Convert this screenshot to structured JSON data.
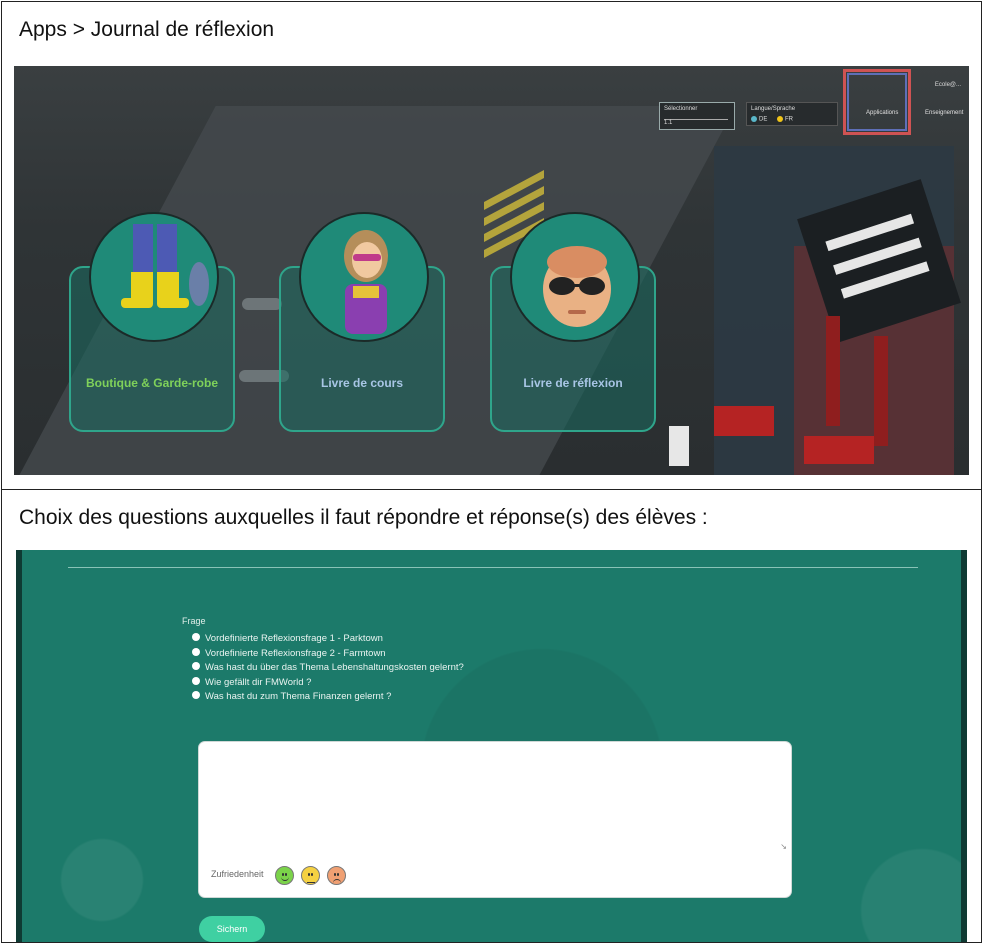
{
  "captions": {
    "apps_path": "Apps > Journal de réflexion",
    "choice_text": "Choix des questions auxquelles il faut répondre et réponse(s) des élèves :"
  },
  "apps_screen": {
    "topbar": {
      "email": "Ecole@...",
      "select_label": "Sélectionner",
      "select_value": "1.1",
      "language_label": "Langue/Sprache",
      "language_options": [
        "DE",
        "FR"
      ],
      "menu_apps": "Applications",
      "menu_education": "Enseignement"
    },
    "cards": [
      {
        "label": "Boutique & Garde-robe",
        "icon": "costume-icon"
      },
      {
        "label": "Livre de cours",
        "icon": "avatar-girl-icon"
      },
      {
        "label": "Livre de réflexion",
        "icon": "avatar-sunglasses-icon"
      }
    ],
    "colors": {
      "card_border": "#2fa58b",
      "highlight": "#cf5353",
      "label_active": "#7fd15a"
    }
  },
  "reflection_screen": {
    "frage_title": "Frage",
    "questions": [
      "Vordefinierte Reflexionsfrage 1 - Parktown",
      "Vordefinierte Reflexionsfrage 2 - Farmtown",
      "Was hast du über das Thema Lebenshaltungskosten gelernt?",
      "Wie gefällt dir FMWorld ?",
      "Was hast du zum Thema Finanzen gelernt ?"
    ],
    "answer_placeholder": "",
    "satisfaction_label": "Zufriedenheit",
    "smileys": [
      "happy-smiley-icon",
      "neutral-smiley-icon",
      "sad-smiley-icon"
    ],
    "save_label": "Sichern",
    "colors": {
      "background": "#1c7a6a",
      "save_button": "#3fd0a2"
    }
  }
}
